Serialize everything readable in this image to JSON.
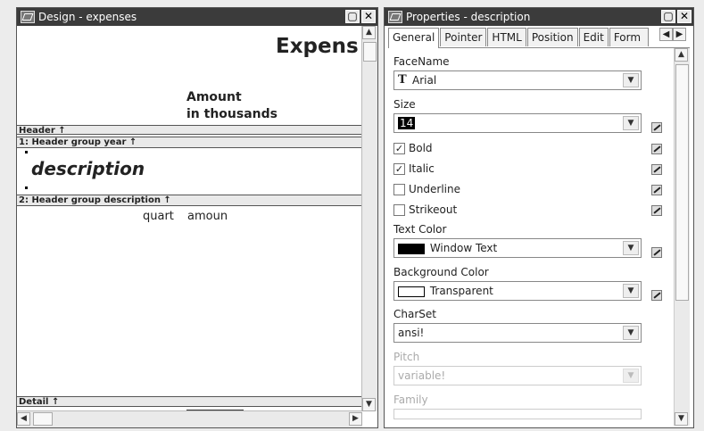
{
  "design": {
    "title": "Design - expenses",
    "report_title": "Expens",
    "amount_line1": "Amount",
    "amount_line2": "in thousands",
    "bands": {
      "header": "Header ↑",
      "group1": "1: Header group year ↑",
      "group2": "2: Header group description ↑",
      "detail": "Detail ↑"
    },
    "description_field": "description",
    "quart_field": "quart",
    "amount_field": "amoun"
  },
  "properties": {
    "title": "Properties - description",
    "tabs": [
      "General",
      "Pointer",
      "HTML",
      "Position",
      "Edit",
      "Form"
    ],
    "facename_label": "FaceName",
    "facename_value": "Arial",
    "size_label": "Size",
    "size_value": "14",
    "bold_label": "Bold",
    "bold_checked": true,
    "italic_label": "Italic",
    "italic_checked": true,
    "underline_label": "Underline",
    "underline_checked": false,
    "strikeout_label": "Strikeout",
    "strikeout_checked": false,
    "text_color_label": "Text Color",
    "text_color_value": "Window Text",
    "text_color_swatch": "#000000",
    "bg_color_label": "Background Color",
    "bg_color_value": "Transparent",
    "charset_label": "CharSet",
    "charset_value": "ansi!",
    "pitch_label": "Pitch",
    "pitch_value": "variable!",
    "family_label": "Family"
  },
  "colors": {
    "titlebar": "#3b3b3b",
    "band": "#e9e9e9"
  }
}
